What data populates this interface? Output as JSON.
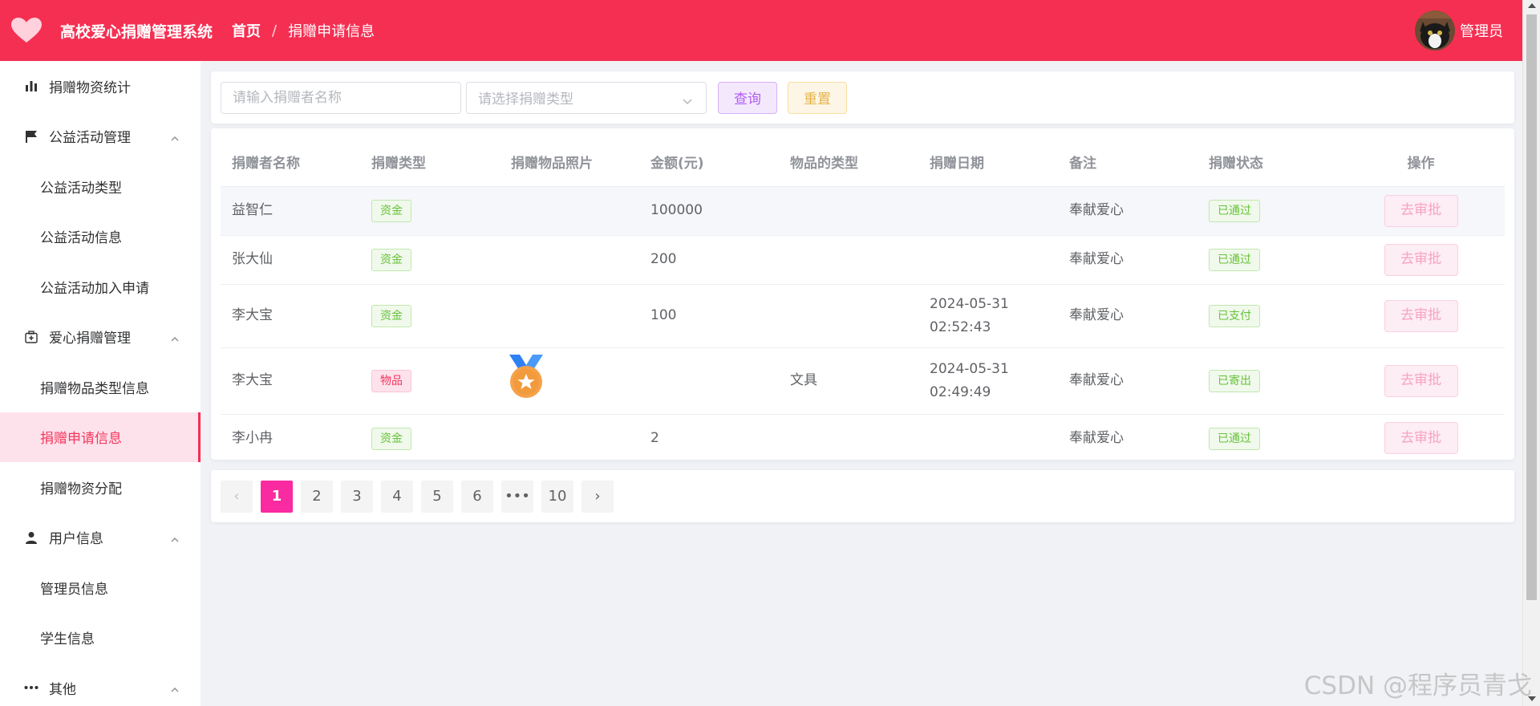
{
  "header": {
    "app_title": "高校爱心捐赠管理系统",
    "breadcrumb": [
      "首页",
      "捐赠申请信息"
    ],
    "breadcrumb_separator": "/",
    "username": "管理员",
    "logo_icon": "heart-icon",
    "accent_color": "#f52f52"
  },
  "sidebar": {
    "items": [
      {
        "label": "捐赠物资统计",
        "icon": "bar-chart-icon",
        "level": "top"
      },
      {
        "label": "公益活动管理",
        "icon": "flag-icon",
        "level": "top",
        "expanded": true
      },
      {
        "label": "公益活动类型",
        "level": "sub"
      },
      {
        "label": "公益活动信息",
        "level": "sub"
      },
      {
        "label": "公益活动加入申请",
        "level": "sub"
      },
      {
        "label": "爱心捐赠管理",
        "icon": "first-aid-kit-icon",
        "level": "top",
        "expanded": true
      },
      {
        "label": "捐赠物品类型信息",
        "level": "sub"
      },
      {
        "label": "捐赠申请信息",
        "level": "sub",
        "active": true
      },
      {
        "label": "捐赠物资分配",
        "level": "sub"
      },
      {
        "label": "用户信息",
        "icon": "user-icon",
        "level": "top",
        "expanded": true
      },
      {
        "label": "管理员信息",
        "level": "sub"
      },
      {
        "label": "学生信息",
        "level": "sub"
      },
      {
        "label": "其他",
        "icon": "more-dots-icon",
        "level": "top",
        "expanded": true
      }
    ]
  },
  "search": {
    "name_placeholder": "请输入捐赠者名称",
    "type_placeholder": "请选择捐赠类型",
    "query_label": "查询",
    "reset_label": "重置"
  },
  "table": {
    "columns": [
      "捐赠者名称",
      "捐赠类型",
      "捐赠物品照片",
      "金额(元)",
      "物品的类型",
      "捐赠日期",
      "备注",
      "捐赠状态",
      "操作"
    ],
    "rows": [
      {
        "donor": "益智仁",
        "type": "资金",
        "photo": "",
        "amount": "100000",
        "item_type": "",
        "date": "",
        "time": "",
        "note": "奉献爱心",
        "status": "已通过",
        "action": "去审批"
      },
      {
        "donor": "张大仙",
        "type": "资金",
        "photo": "",
        "amount": "200",
        "item_type": "",
        "date": "",
        "time": "",
        "note": "奉献爱心",
        "status": "已通过",
        "action": "去审批"
      },
      {
        "donor": "李大宝",
        "type": "资金",
        "photo": "",
        "amount": "100",
        "item_type": "",
        "date": "2024-05-31",
        "time": "02:52:43",
        "note": "奉献爱心",
        "status": "已支付",
        "action": "去审批"
      },
      {
        "donor": "李大宝",
        "type": "物品",
        "photo": "medal-icon",
        "amount": "",
        "item_type": "文具",
        "date": "2024-05-31",
        "time": "02:49:49",
        "note": "奉献爱心",
        "status": "已寄出",
        "action": "去审批"
      },
      {
        "donor": "李小冉",
        "type": "资金",
        "photo": "",
        "amount": "2",
        "item_type": "",
        "date": "",
        "time": "",
        "note": "奉献爱心",
        "status": "已通过",
        "action": "去审批"
      }
    ]
  },
  "pagination": {
    "pages": [
      "1",
      "2",
      "3",
      "4",
      "5",
      "6",
      "•••",
      "10"
    ],
    "current": "1",
    "prev_symbol": "‹",
    "next_symbol": "›"
  },
  "watermark": "CSDN @程序员青戈"
}
